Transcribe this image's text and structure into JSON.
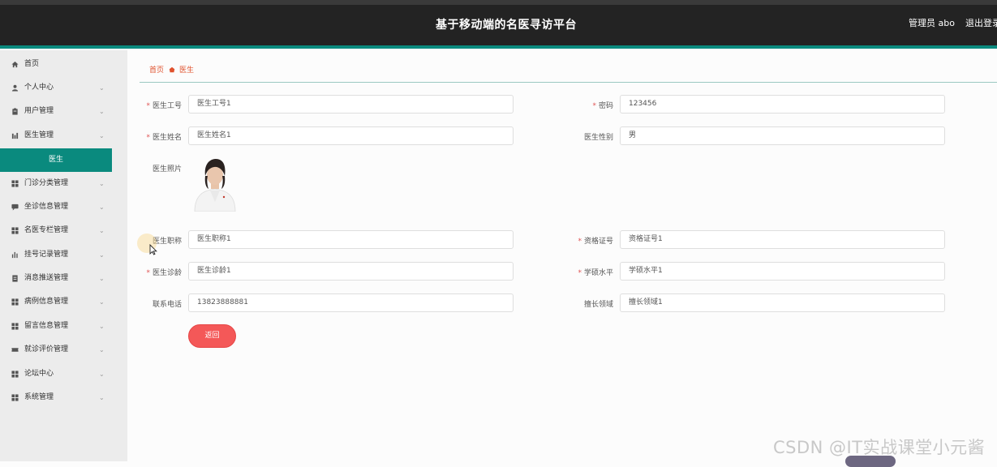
{
  "header": {
    "title": "基于移动端的名医寻访平台",
    "user": "管理员 abo",
    "logout": "退出登录"
  },
  "sidebar": {
    "items": [
      {
        "label": "首页",
        "icon": "home-icon",
        "chevron": false
      },
      {
        "label": "个人中心",
        "icon": "person-icon",
        "chevron": true
      },
      {
        "label": "用户管理",
        "icon": "clipboard-icon",
        "chevron": true
      },
      {
        "label": "医生管理",
        "icon": "chart-icon",
        "chevron": true
      },
      {
        "label": "门诊分类管理",
        "icon": "grid-icon",
        "chevron": true
      },
      {
        "label": "坐诊信息管理",
        "icon": "chat-icon",
        "chevron": true
      },
      {
        "label": "名医专栏管理",
        "icon": "grid-icon",
        "chevron": true
      },
      {
        "label": "挂号记录管理",
        "icon": "bars-icon",
        "chevron": true
      },
      {
        "label": "消息推送管理",
        "icon": "document-icon",
        "chevron": true
      },
      {
        "label": "病例信息管理",
        "icon": "grid-icon",
        "chevron": true
      },
      {
        "label": "留言信息管理",
        "icon": "grid-icon",
        "chevron": true
      },
      {
        "label": "就诊评价管理",
        "icon": "ticket-icon",
        "chevron": true
      },
      {
        "label": "论坛中心",
        "icon": "grid-icon",
        "chevron": true
      },
      {
        "label": "系统管理",
        "icon": "grid-icon",
        "chevron": true
      }
    ],
    "active_sub": "医生",
    "chevron_glyph": "⌄"
  },
  "breadcrumb": {
    "home": "首页",
    "current": "医生"
  },
  "form": {
    "doctor_id": {
      "label": "医生工号",
      "value": "医生工号1",
      "required": true
    },
    "password": {
      "label": "密码",
      "value": "123456",
      "required": true
    },
    "doctor_name": {
      "label": "医生姓名",
      "value": "医生姓名1",
      "required": true
    },
    "gender": {
      "label": "医生性别",
      "value": "男",
      "required": false
    },
    "photo": {
      "label": "医生照片"
    },
    "title": {
      "label": "医生职称",
      "value": "医生职称1",
      "required": false
    },
    "cert_no": {
      "label": "资格证号",
      "value": "资格证号1",
      "required": true
    },
    "years": {
      "label": "医生诊龄",
      "value": "医生诊龄1",
      "required": true
    },
    "degree": {
      "label": "学硕水平",
      "value": "学硕水平1",
      "required": true
    },
    "phone": {
      "label": "联系电话",
      "value": "13823888881",
      "required": false
    },
    "specialty": {
      "label": "擅长领域",
      "value": "擅长领域1",
      "required": false
    }
  },
  "buttons": {
    "back": "返回"
  },
  "watermark": "CSDN @IT实战课堂小元酱",
  "colors": {
    "header_bg": "#232323",
    "accent_teal": "#0a8a7e",
    "breadcrumb": "#e0522e",
    "back_button": "#f45858",
    "required_star": "#e05454"
  }
}
